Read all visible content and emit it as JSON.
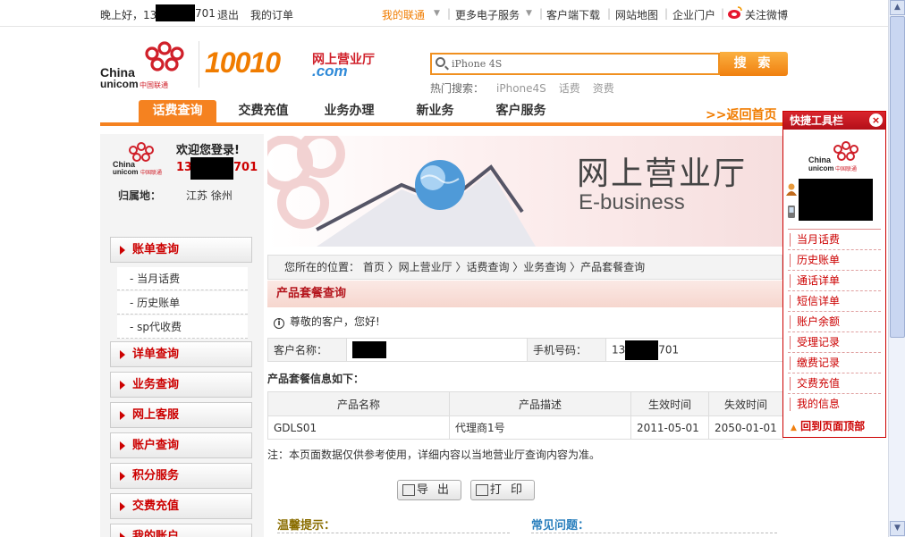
{
  "topbar": {
    "greeting": "晚上好，13",
    "phone_suffix": "701",
    "logout": "退出",
    "my_orders": "我的订单",
    "my_unicom": "我的联通",
    "more_services": "更多电子服务",
    "client_download": "客户端下载",
    "sitemap": "网站地图",
    "enterprise_portal": "企业门户",
    "weibo": "关注微博"
  },
  "header": {
    "logo_en1": "China",
    "logo_en2": "unicom",
    "logo_cn": "中国联通",
    "brand_number": "10010",
    "brand_hall": "网上营业厅",
    "brand_com": ".com"
  },
  "search": {
    "value": "iPhone 4S",
    "button": "搜 索",
    "hot_label": "热门搜索：",
    "hot_terms": [
      "iPhone4S",
      "话费",
      "资费"
    ]
  },
  "nav": {
    "items": [
      "话费查询",
      "交费充值",
      "业务办理",
      "新业务",
      "客户服务"
    ],
    "return_home": ">>返回首页"
  },
  "welcome": {
    "title": "欢迎您登录!",
    "phone_prefix": "13",
    "phone_suffix": "701",
    "location_label": "归属地：",
    "location_value": "江苏 徐州"
  },
  "left_menu": {
    "bill_query": "账单查询",
    "sub_items": [
      "- 当月话费",
      "- 历史账单",
      "- sp代收费"
    ],
    "heads": [
      "详单查询",
      "业务查询",
      "网上客服",
      "账户查询",
      "积分服务",
      "交费充值",
      "我的账户"
    ]
  },
  "banner": {
    "title": "网上营业厅",
    "subtitle": "E-business"
  },
  "breadcrumb": {
    "text": "您所在的位置：  首页 〉网上营业厅 〉话费查询 〉业务查询 〉产品套餐查询"
  },
  "section": {
    "title": "产品套餐查询",
    "greeting": "尊敬的客户，您好!"
  },
  "customer": {
    "name_label": "客户名称：",
    "phone_label": "手机号码：",
    "phone_prefix": "13",
    "phone_suffix": "701"
  },
  "package": {
    "caption": "产品套餐信息如下：",
    "headers": [
      "产品名称",
      "产品描述",
      "生效时间",
      "失效时间"
    ],
    "rows": [
      [
        "GDLS01",
        "代理商1号",
        "2011-05-01",
        "2050-01-01"
      ]
    ]
  },
  "note": "注：本页面数据仅供参考使用，详细内容以当地营业厅查询内容为准。",
  "actions": {
    "export": "导 出",
    "print": "打 印"
  },
  "bottom": {
    "tip_title": "温馨提示：",
    "faq_title": "常见问题："
  },
  "quick_toolbar": {
    "title": "快捷工具栏",
    "close": "×",
    "items": [
      "当月话费",
      "历史账单",
      "通话详单",
      "短信详单",
      "账户余额",
      "受理记录",
      "缴费记录",
      "交费充值",
      "我的信息"
    ],
    "back_to_top": "回到页面顶部"
  },
  "colors": {
    "brand_orange": "#f58220",
    "brand_red": "#c00000",
    "link_blue": "#2a7fbd"
  }
}
